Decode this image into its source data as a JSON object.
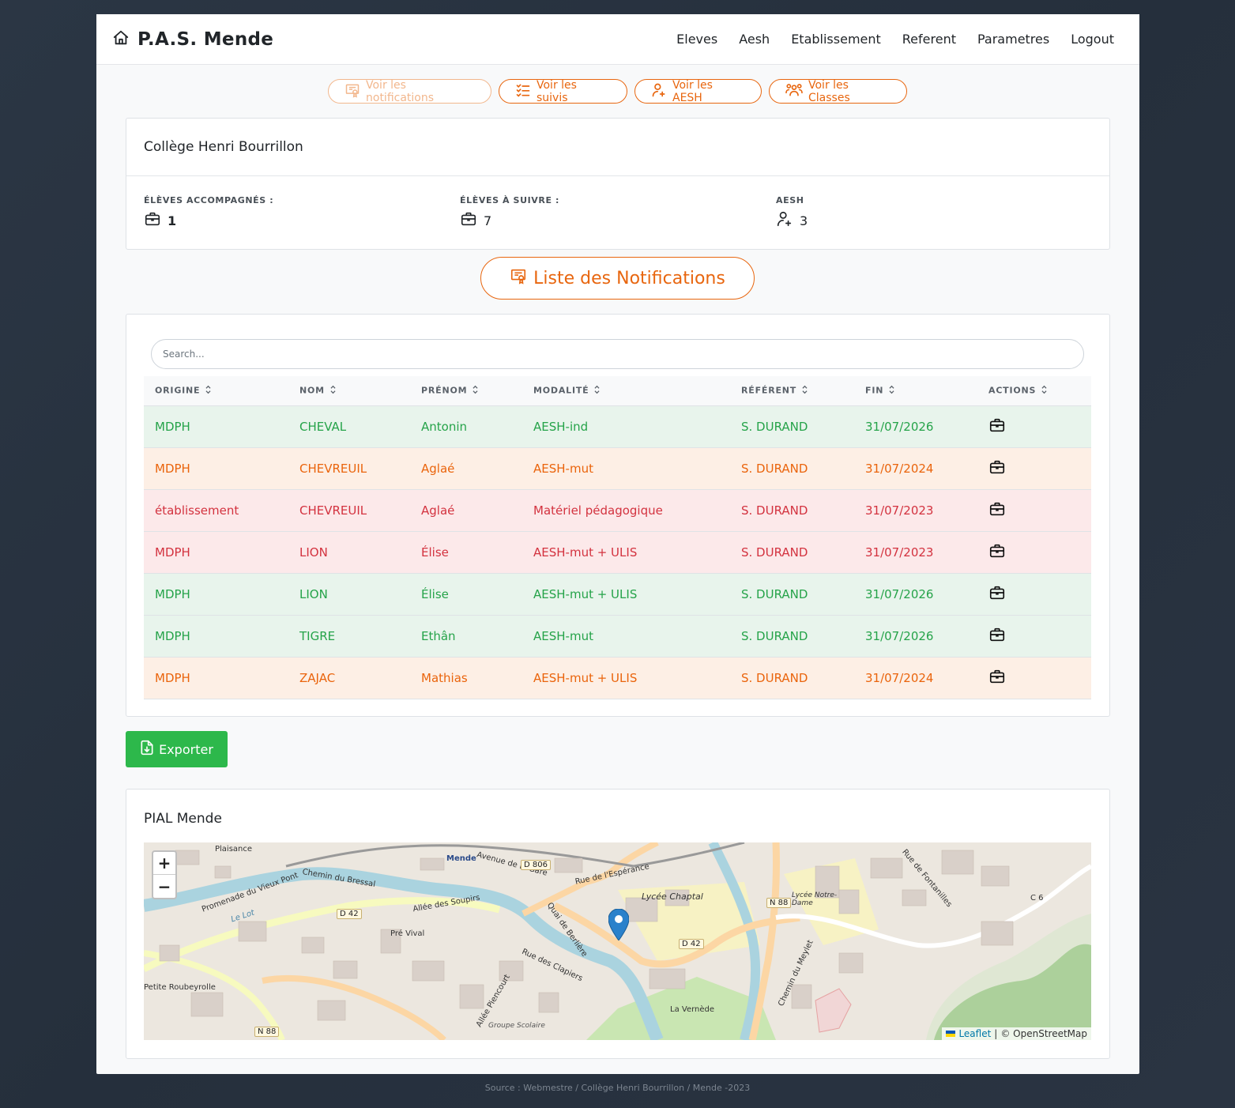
{
  "navbar": {
    "brand": "P.A.S. Mende",
    "links": [
      "Eleves",
      "Aesh",
      "Etablissement",
      "Referent",
      "Parametres",
      "Logout"
    ]
  },
  "quick_buttons": [
    {
      "label": "Voir les notifications",
      "icon": "certificate-icon",
      "disabled": true
    },
    {
      "label": "Voir les suivis",
      "icon": "checklist-icon",
      "disabled": false
    },
    {
      "label": "Voir les AESH",
      "icon": "user-plus-icon",
      "disabled": false
    },
    {
      "label": "Voir les Classes",
      "icon": "users-icon",
      "disabled": false
    }
  ],
  "school": {
    "name": "Collège Henri Bourrillon",
    "stats": [
      {
        "label": "ÉLÈVES ACCOMPAGNÉS :",
        "value": "1",
        "icon": "briefcase-icon"
      },
      {
        "label": "ÉLÈVES À SUIVRE :",
        "value": "7",
        "icon": "briefcase-icon"
      },
      {
        "label": "AESH",
        "value": "3",
        "icon": "user-plus-icon"
      }
    ]
  },
  "notifications_title": "Liste des Notifications",
  "search": {
    "placeholder": "Search..."
  },
  "table": {
    "headers": [
      "ORIGINE",
      "NOM",
      "PRÉNOM",
      "MODALITÉ",
      "RÉFÉRENT",
      "FIN",
      "ACTIONS"
    ],
    "rows": [
      {
        "status": "green",
        "origine": "MDPH",
        "nom": "CHEVAL",
        "prenom": "Antonin",
        "modalite": "AESH-ind",
        "referent": "S. DURAND",
        "fin": "31/07/2026"
      },
      {
        "status": "orange",
        "origine": "MDPH",
        "nom": "CHEVREUIL",
        "prenom": "Aglaé",
        "modalite": "AESH-mut",
        "referent": "S. DURAND",
        "fin": "31/07/2024"
      },
      {
        "status": "red",
        "origine": "établissement",
        "nom": "CHEVREUIL",
        "prenom": "Aglaé",
        "modalite": "Matériel pédagogique",
        "referent": "S. DURAND",
        "fin": "31/07/2023"
      },
      {
        "status": "red",
        "origine": "MDPH",
        "nom": "LION",
        "prenom": "Élise",
        "modalite": "AESH-mut + ULIS",
        "referent": "S. DURAND",
        "fin": "31/07/2023"
      },
      {
        "status": "green",
        "origine": "MDPH",
        "nom": "LION",
        "prenom": "Élise",
        "modalite": "AESH-mut + ULIS",
        "referent": "S. DURAND",
        "fin": "31/07/2026"
      },
      {
        "status": "green",
        "origine": "MDPH",
        "nom": "TIGRE",
        "prenom": "Ethân",
        "modalite": "AESH-mut",
        "referent": "S. DURAND",
        "fin": "31/07/2026"
      },
      {
        "status": "orange",
        "origine": "MDPH",
        "nom": "ZAJAC",
        "prenom": "Mathias",
        "modalite": "AESH-mut + ULIS",
        "referent": "S. DURAND",
        "fin": "31/07/2024"
      }
    ]
  },
  "export_label": "Exporter",
  "map": {
    "title": "PIAL Mende",
    "zoom_in": "+",
    "zoom_out": "−",
    "attribution_leaflet": "Leaflet",
    "attribution_sep": "|",
    "attribution_osm": "© OpenStreetMap",
    "labels": [
      "Plaisance",
      "Mende",
      "Lycée Chaptal",
      "Lycée Notre-Dame",
      "Allée des Soupirs",
      "Pré Vival",
      "La Vernède",
      "Le Lot",
      "Chemin du Bressal",
      "Avenue de la Gare",
      "Rue de l'Espérance",
      "Quai de Berlière",
      "Rue des Clapiers",
      "Allée Piencourt",
      "Chemin du Meylet",
      "Rue de Fontanilles",
      "Promenade du Vieux Pont",
      "Petite Roubeyrolle",
      "Groupe Scolaire"
    ],
    "roads": [
      "D 806",
      "N 88",
      "D 42",
      "D 42",
      "N 88",
      "C 6"
    ]
  },
  "colors": {
    "accent": "#e8660f",
    "success": "#2db84b",
    "row_green": "#25a349",
    "row_orange": "#ea640c",
    "row_red": "#d3323f"
  },
  "footer": "Source : Webmestre / Collège Henri Bourrillon / Mende -2023"
}
